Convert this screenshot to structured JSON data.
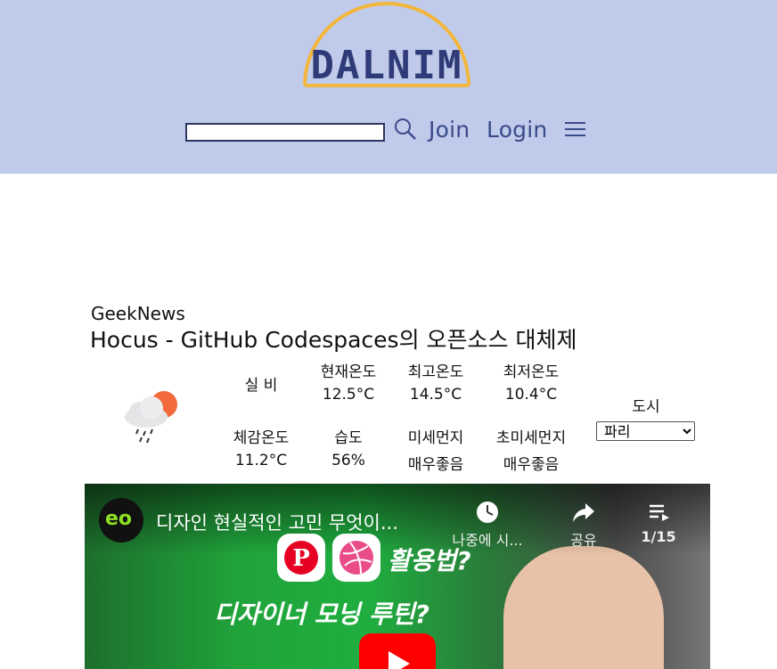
{
  "header": {
    "logo_text": "DALNIM",
    "search": {
      "value": "",
      "placeholder": ""
    },
    "join_label": "Join",
    "login_label": "Login",
    "search_icon": "search-icon",
    "menu_icon": "hamburger-menu-icon"
  },
  "news": {
    "source": "GeekNews",
    "title": "Hocus - GitHub Codespaces의 오픈소스 대체제"
  },
  "weather": {
    "icon": "sun-cloud-rain-icon",
    "labels": {
      "condition": "실 비",
      "current_temp": "현재온도",
      "max_temp": "최고온도",
      "min_temp": "최저온도",
      "feels_like": "체감온도",
      "humidity": "습도",
      "pm10": "미세먼지",
      "pm25": "초미세먼지",
      "city": "도시"
    },
    "values": {
      "current_temp": "12.5°C",
      "max_temp": "14.5°C",
      "min_temp": "10.4°C",
      "feels_like": "11.2°C",
      "humidity": "56%",
      "pm10": "매우좋음",
      "pm25": "매우좋음"
    },
    "city_selected": "파리"
  },
  "video": {
    "title": "디자인 현실적인 고민 무엇이...",
    "watch_later_label": "나중에 시...",
    "share_label": "공유",
    "playlist_count": "1/15",
    "overlay_line1": "활용법?",
    "overlay_line2": "디자이너 모닝 루틴?",
    "channel_logo_text": "eo",
    "colors": {
      "play_button": "#ff0000",
      "channel_accent": "#8fe024"
    }
  },
  "colors": {
    "header_bg": "#c0cbeb",
    "nav_text": "#3a4a8a",
    "logo_arc": "#f3b63c",
    "logo_text": "#2f3a78"
  }
}
